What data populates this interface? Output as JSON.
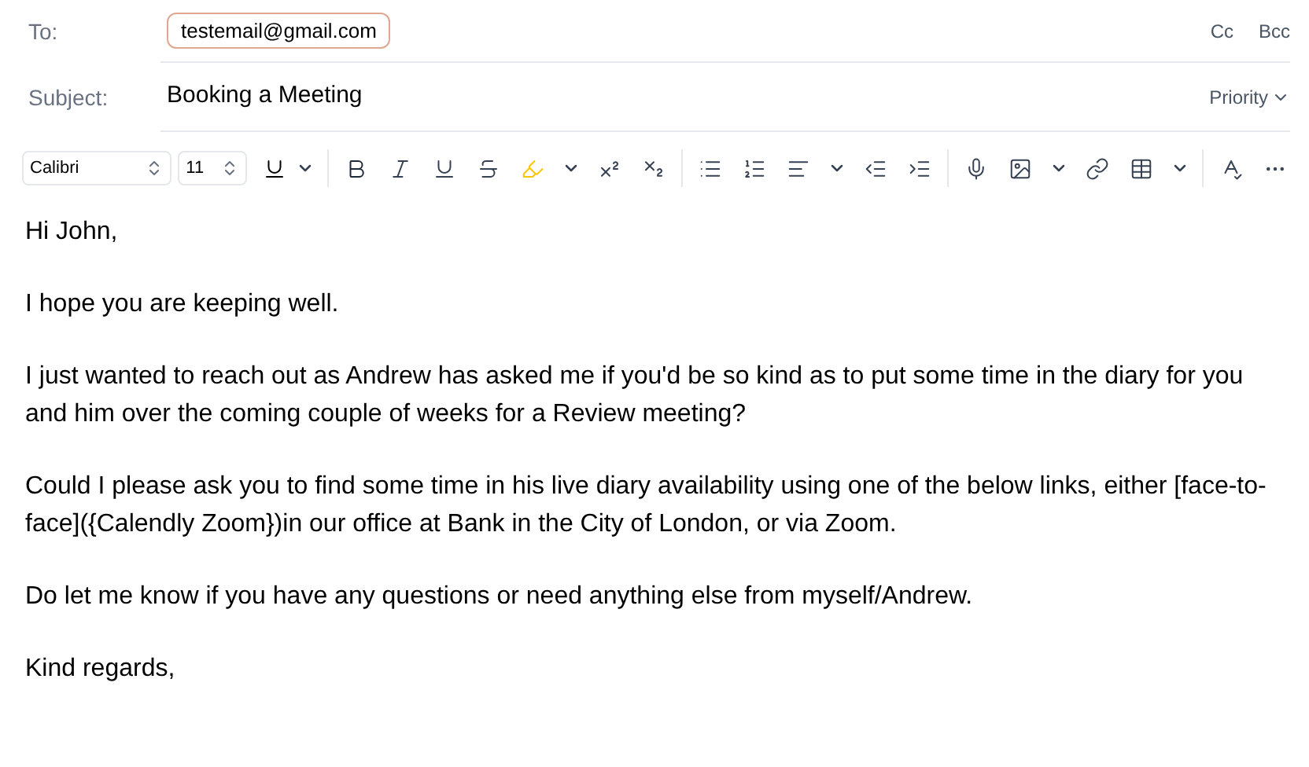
{
  "to": {
    "label": "To:",
    "recipients": [
      "testemail@gmail.com"
    ],
    "cc": "Cc",
    "bcc": "Bcc"
  },
  "subject": {
    "label": "Subject:",
    "value": "Booking a Meeting",
    "priority": "Priority"
  },
  "toolbar": {
    "font": "Calibri",
    "size": "11"
  },
  "body": [
    "Hi John,",
    "I hope you are keeping well.",
    "I just wanted to reach out as Andrew has asked me if you'd be so kind as to put some time in the diary for you and him over the coming couple of weeks for a Review meeting?",
    "Could I please ask you to find some time in his live diary availability using one of the below links, either [face-to-face]({Calendly Zoom})in our office at Bank in the City of London, or via Zoom.",
    "Do let me know if you have any questions or need anything else from myself/Andrew.",
    "Kind regards,"
  ]
}
